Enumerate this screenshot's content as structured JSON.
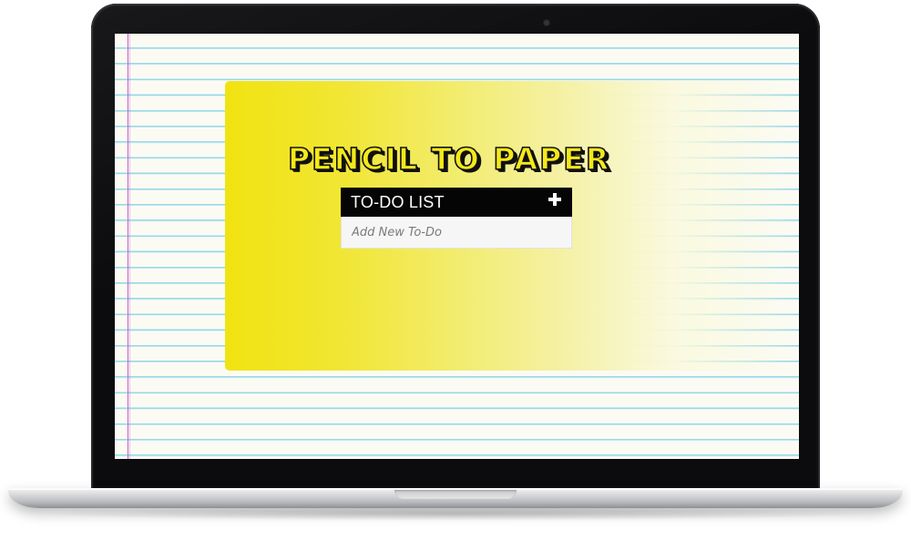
{
  "app": {
    "title": "PENCIL TO PAPER"
  },
  "todo": {
    "header_label": "TO-DO LIST",
    "add_icon": "plus-icon",
    "input_placeholder": "Add New To-Do",
    "input_value": ""
  },
  "theme": {
    "accent_yellow": "#f1e311",
    "header_black": "#050505",
    "paper": "#fbfbf4",
    "rule_line": "#8fd6e6",
    "margin_line": "#c25bc4"
  }
}
